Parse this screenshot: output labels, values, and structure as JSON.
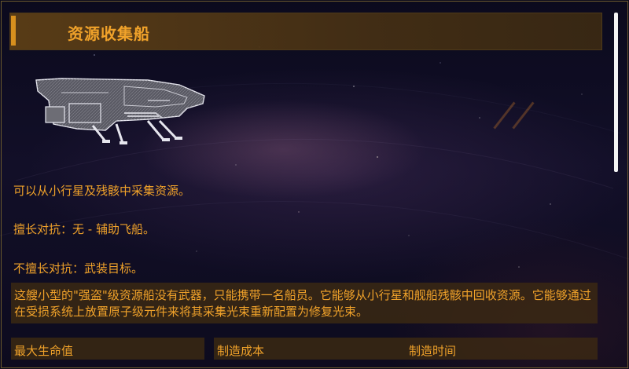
{
  "panel": {
    "title": "资源收集船"
  },
  "ship": {
    "icon": "resource-collector-ship-icon",
    "colors": {
      "hull": "#6d6d75",
      "hull_highlight": "#c8c8d0",
      "outline": "#e6e6ee"
    }
  },
  "info": {
    "capability": "可以从小行星及残骸中采集资源。",
    "strong_against": "擅长对抗：无 - 辅助飞船。",
    "weak_against": "不擅长对抗：武装目标。",
    "description": "这艘小型的\"强盗\"级资源船没有武器，只能携带一名船员。它能够从小行星和舰船残骸中回收资源。它能够通过在受损系统上放置原子级元件来将其采集光束重新配置为修复光束。"
  },
  "stats": {
    "max_hp_label": "最大生命值",
    "build_cost_label": "制造成本",
    "build_time_label": "制造时间"
  },
  "colors": {
    "accent": "#f0a22a",
    "title_marker": "#d8901e",
    "panel_fill": "#5c3e16",
    "frame_border": "#6b5a2e",
    "scrollbar": "#f4f4f4",
    "background": "#0c0a1c"
  }
}
